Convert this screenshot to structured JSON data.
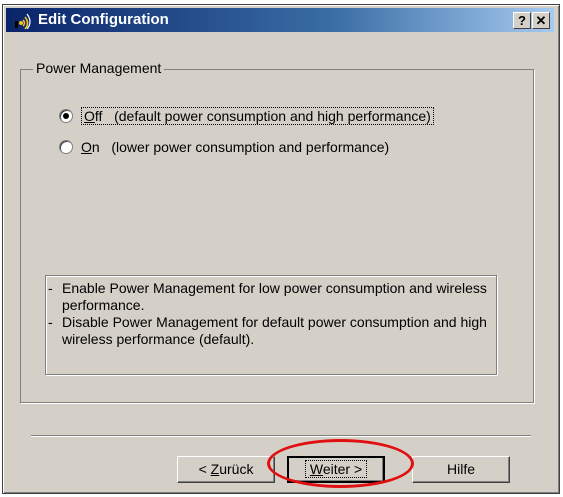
{
  "window": {
    "title": "Edit Configuration",
    "help_button": "?",
    "close_button": "✕"
  },
  "group": {
    "label": "Power Management"
  },
  "options": [
    {
      "mnemonic": "O",
      "rest": "ff",
      "description": "(default power consumption and high performance)",
      "checked": true
    },
    {
      "mnemonic": "O",
      "rest": "n",
      "description": "(lower power consumption and performance)",
      "checked": false
    }
  ],
  "info": {
    "lines": [
      {
        "dash": "-",
        "text": "Enable Power Management for low power consumption and wireless performance."
      },
      {
        "dash": "-",
        "text": "Disable Power Management for default power consumption and high wireless performance (default)."
      }
    ]
  },
  "buttons": {
    "back": {
      "prefix": "< ",
      "mnemonic": "Z",
      "rest": "urück"
    },
    "next": {
      "mnemonic": "W",
      "rest": "eiter >"
    },
    "help": "Hilfe"
  },
  "colors": {
    "dialog_face": "#d4d0c8",
    "title_start": "#0a246a",
    "title_end": "#a6caf0",
    "highlight": "#e01010"
  }
}
